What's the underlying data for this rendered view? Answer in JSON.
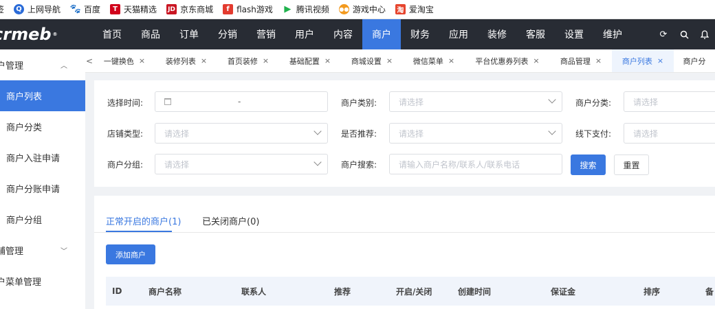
{
  "bookmarks": [
    {
      "label": "签",
      "icon": "bookmark-icon",
      "color": "#ffffff"
    },
    {
      "label": "上网导航",
      "icon": "search-q-icon",
      "color": "#2a6bd8"
    },
    {
      "label": "百度",
      "icon": "baidu-paw-icon",
      "color": "#2f63d6"
    },
    {
      "label": "天猫精选",
      "icon": "tmall-icon",
      "color": "#d0021b"
    },
    {
      "label": "京东商城",
      "icon": "jd-icon",
      "color": "#c91623"
    },
    {
      "label": "flash游戏",
      "icon": "flash-icon",
      "color": "#e33b2f"
    },
    {
      "label": "腾讯视频",
      "icon": "tencent-video-icon",
      "color": "#20b24d"
    },
    {
      "label": "游戏中心",
      "icon": "gamepad-icon",
      "color": "#f39a1f"
    },
    {
      "label": "爱淘宝",
      "icon": "taobao-icon",
      "color": "#e6452e"
    }
  ],
  "brand": {
    "logo_text": "crmeb",
    "reg": "®"
  },
  "nav": {
    "items": [
      "首页",
      "商品",
      "订单",
      "分销",
      "营销",
      "用户",
      "内容",
      "商户",
      "财务",
      "应用",
      "装修",
      "客服",
      "设置",
      "维护"
    ],
    "active_index": 7,
    "icons": [
      "refresh-icon",
      "search-icon",
      "bell-icon"
    ]
  },
  "sidebar": {
    "group1": "户管理",
    "items": [
      "商户列表",
      "商户分类",
      "商户入驻申请",
      "商户分账申请",
      "商户分组"
    ],
    "active_index": 0,
    "group2": "铺管理",
    "group3": "户菜单管理"
  },
  "tabs": {
    "items": [
      "一键换色",
      "装修列表",
      "首页装修",
      "基础配置",
      "商城设置",
      "微信菜单",
      "平台优惠券列表",
      "商品管理",
      "商户列表",
      "商户分"
    ],
    "active_index": 8,
    "close": "×",
    "prev": "<"
  },
  "filter": {
    "time_label": "选择时间:",
    "time_sep": "-",
    "category_label": "商户类别:",
    "category_placeholder": "请选择",
    "class_label": "商户分类:",
    "class_placeholder": "请选择",
    "store_type_label": "店铺类型:",
    "store_type_placeholder": "请选择",
    "recommend_label": "是否推荐:",
    "recommend_placeholder": "请选择",
    "offline_pay_label": "线下支付:",
    "offline_pay_placeholder": "请选择",
    "group_label": "商户分组:",
    "group_placeholder": "请选择",
    "search_label": "商户搜索:",
    "search_placeholder": "请输入商户名称/联系人/联系电话",
    "search_button": "搜索",
    "reset_button": "重置"
  },
  "list": {
    "tab_open": "正常开启的商户(1)",
    "tab_closed": "已关闭商户(0)",
    "add_button": "添加商户",
    "columns": [
      "ID",
      "商户名称",
      "联系人",
      "推荐",
      "开启/关闭",
      "创建时间",
      "保证金",
      "排序",
      "备"
    ]
  }
}
